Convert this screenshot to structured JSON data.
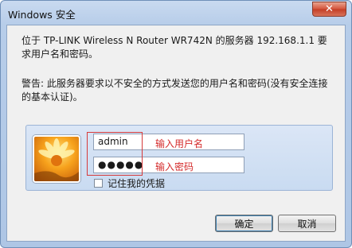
{
  "window": {
    "title": "Windows 安全",
    "close_glyph": "✕"
  },
  "dialog": {
    "message": "位于 TP-LINK Wireless N Router WR742N 的服务器 192.168.1.1 要求用户名和密码。",
    "warning": "警告: 此服务器要求以不安全的方式发送您的用户名和密码(没有安全连接的基本认证)。"
  },
  "credentials": {
    "username_value": "admin",
    "password_value": "●●●●●",
    "username_hint": "输入用户名",
    "password_hint": "输入密码",
    "remember_label": "记住我的凭据",
    "remember_checked": false,
    "avatar_icon": "flower-avatar-icon"
  },
  "buttons": {
    "ok_label": "确定",
    "cancel_label": "取消"
  },
  "colors": {
    "annotation_red": "#d42a2a",
    "title_bar": "#b7cde9",
    "panel": "#d3e1f4"
  }
}
